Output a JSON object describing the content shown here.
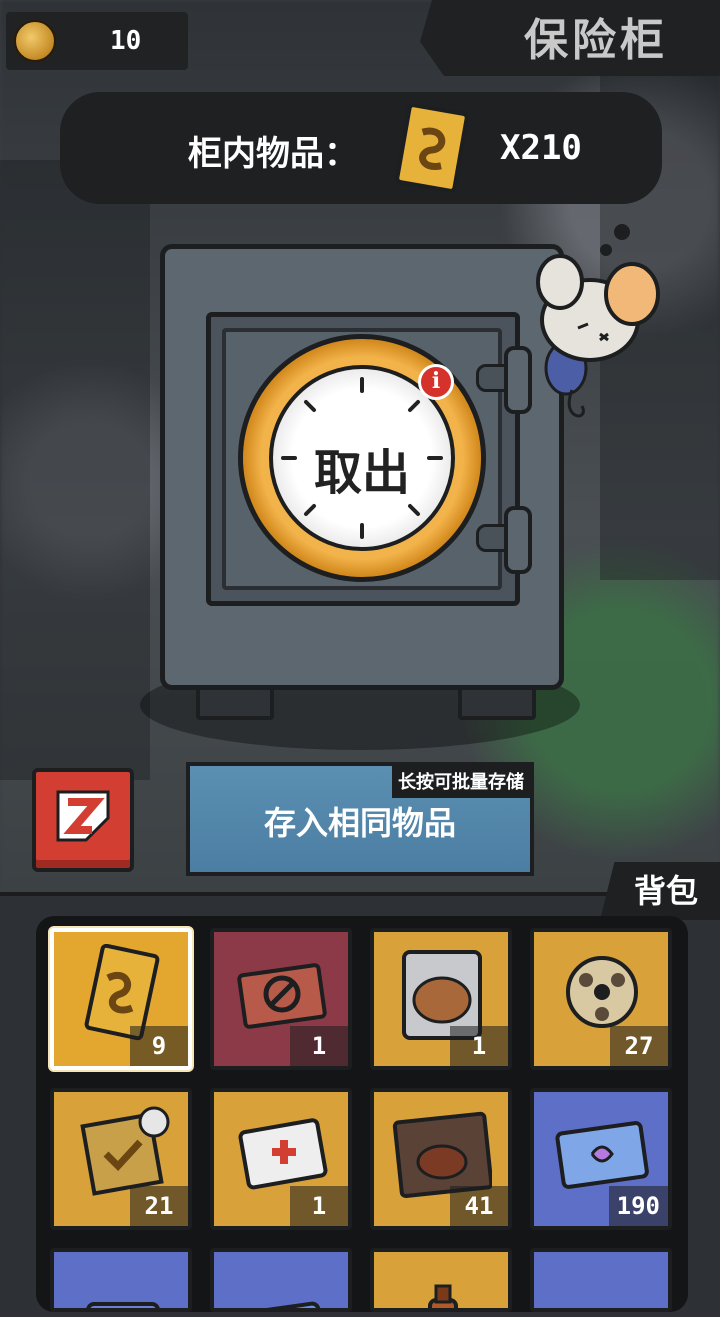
{
  "currency": {
    "value": "10",
    "icon": "coin-icon"
  },
  "page_title": "保险柜",
  "safe_contents": {
    "label": "柜内物品：",
    "count": "X210",
    "icon": "gold-card-icon"
  },
  "safe": {
    "withdraw_label": "取出",
    "info_badge": "i"
  },
  "actions": {
    "store_label": "存入相同物品",
    "store_hint": "长按可批量存储",
    "exit_icon": "exit-icon"
  },
  "backpack": {
    "label": "背包",
    "slots": [
      {
        "name": "gold-card",
        "count": "9",
        "bg": "#e3a62f",
        "selected": true
      },
      {
        "name": "ticket",
        "count": "1",
        "bg": "#8c3a48",
        "selected": false
      },
      {
        "name": "capybara-snack",
        "count": "1",
        "bg": "#d8a13a",
        "selected": false
      },
      {
        "name": "film-reel",
        "count": "27",
        "bg": "#d8a13a",
        "selected": false
      },
      {
        "name": "gold-badge",
        "count": "21",
        "bg": "#d8a13a",
        "selected": false
      },
      {
        "name": "medical-card",
        "count": "1",
        "bg": "#d8a13a",
        "selected": false
      },
      {
        "name": "steak-pack",
        "count": "41",
        "bg": "#d8a13a",
        "selected": false
      },
      {
        "name": "toy-ticket",
        "count": "190",
        "bg": "#5e6fc8",
        "selected": false
      },
      {
        "name": "blue-item",
        "count": "",
        "bg": "#5e6fc8",
        "selected": false
      },
      {
        "name": "blue-card",
        "count": "",
        "bg": "#5e6fc8",
        "selected": false
      },
      {
        "name": "sauce-bottle",
        "count": "",
        "bg": "#d8a13a",
        "selected": false
      },
      {
        "name": "medkit",
        "count": "",
        "bg": "#5e6fc8",
        "selected": false
      }
    ]
  }
}
